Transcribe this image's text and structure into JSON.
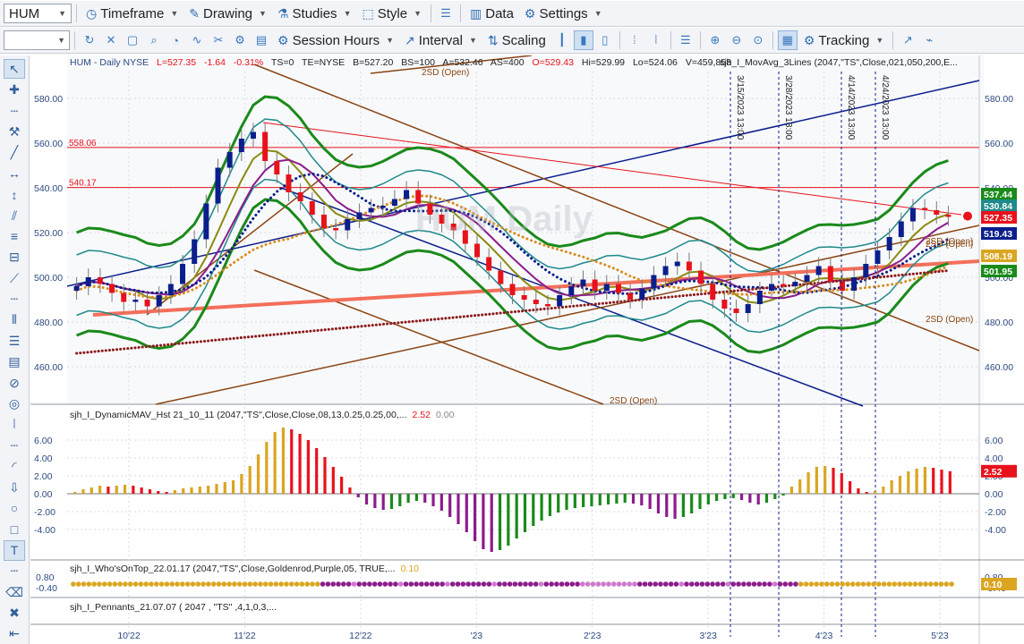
{
  "toolbar_top": {
    "symbol": "HUM",
    "items": [
      "Timeframe",
      "Drawing",
      "Studies",
      "Style",
      "Data",
      "Settings"
    ]
  },
  "toolbar_second": {
    "items": [
      "Session Hours",
      "Interval",
      "Scaling",
      "Tracking"
    ]
  },
  "header": {
    "symbol_line": "HUM - Daily  NYSE",
    "last": "L=527.35",
    "change": "-1.64",
    "pct": "-0.31%",
    "ts": "TS=0",
    "te": "TE=NYSE",
    "bid": "B=527.20",
    "bs": "BS=100",
    "ask": "A=532.46",
    "as": "AS=400",
    "open": "O=529.43",
    "hi": "Hi=529.99",
    "lo": "Lo=524.06",
    "vol": "V=459,858",
    "study": "sjh_I_MovAvg_3Lines (2047,\"TS\",Close,021,050,200,E..."
  },
  "colors": {
    "red": "#e8121b",
    "green": "#1a8a1a",
    "purple": "#8c1c8c",
    "goldenrod": "#daa520",
    "navy": "#0a1e8c",
    "brown": "#8b4513",
    "salmon": "#f36f5a",
    "teal": "#1f8a8a"
  },
  "chart_data": [
    {
      "type": "line",
      "title": "HUM Daily",
      "xlabel": "",
      "ylabel": "",
      "x_tick_labels": [
        "10'22",
        "11'22",
        "12'22",
        "'23",
        "2'23",
        "3'23",
        "4'23",
        "5'23"
      ],
      "y_ticks": [
        460.0,
        480.0,
        500.0,
        520.0,
        540.0,
        560.0,
        580.0
      ],
      "ylim": [
        444,
        592
      ],
      "grid": true,
      "horizontal_levels": [
        {
          "label": "558.06",
          "value": 558.06
        },
        {
          "label": "540.17",
          "value": 540.17
        }
      ],
      "vertical_markers": [
        "3/15/2023 13:00",
        "3/28/2023 13:00",
        "4/14/2023 13:00",
        "4/24/2023 13:00"
      ],
      "annotations": [
        "2SD (Open)",
        "2SD (Open)",
        "2SD (Open)",
        "2SD (Open)",
        "2SD (Open)"
      ],
      "last_values": [
        {
          "label": "537.44",
          "color": "#1a8a1a"
        },
        {
          "label": "530.84",
          "color": "#1f8a8a"
        },
        {
          "label": "527.35",
          "color": "#e8121b"
        },
        {
          "label": "519.43",
          "color": "#0a1e8c"
        },
        {
          "label": "508.19",
          "color": "#daa520"
        },
        {
          "label": "501.95",
          "color": "#1a8a1a"
        }
      ],
      "series": [
        {
          "values": [
            496,
            500,
            497,
            493,
            489,
            490,
            487,
            492,
            497,
            506,
            517,
            533,
            549,
            556,
            562,
            565,
            552,
            546,
            538,
            534,
            528,
            522,
            521,
            526,
            529,
            531,
            532,
            535,
            539,
            533,
            528,
            524,
            521,
            515,
            509,
            503,
            497,
            492,
            490,
            488,
            487,
            492,
            496,
            499,
            494,
            497,
            493,
            490,
            495,
            501,
            505,
            507,
            503,
            497,
            490,
            486,
            484,
            488,
            494,
            497,
            496,
            498,
            501,
            505,
            498,
            494,
            500,
            506,
            512,
            518,
            525,
            531,
            530,
            528,
            527
          ]
        }
      ]
    },
    {
      "type": "bar",
      "title": "sjh_I_DynamicMAV_Hst 21_10_11 (2047,\"TS\",Close,Close,08,13,0.25,0.25,00,...",
      "values_label": [
        "2.52",
        "0.00"
      ],
      "y_ticks": [
        -4.0,
        -2.0,
        0.0,
        2.0,
        4.0,
        6.0
      ],
      "ylim": [
        -7,
        8
      ],
      "last_value": "2.52",
      "values": [
        0.2,
        0.5,
        0.7,
        0.9,
        0.8,
        0.9,
        1.0,
        0.9,
        0.7,
        0.5,
        0.3,
        0.2,
        0.4,
        0.6,
        0.7,
        0.8,
        0.9,
        1.1,
        1.3,
        1.5,
        2.2,
        3.1,
        4.4,
        5.8,
        6.9,
        7.4,
        7.2,
        6.7,
        6.0,
        5.1,
        4.1,
        3.0,
        1.9,
        0.7,
        -0.4,
        -1.2,
        -1.6,
        -1.8,
        -1.7,
        -1.4,
        -1.0,
        -0.8,
        -1.0,
        -1.4,
        -1.9,
        -2.6,
        -3.4,
        -4.3,
        -5.3,
        -6.2,
        -6.5,
        -6.3,
        -5.8,
        -5.0,
        -4.3,
        -3.6,
        -3.0,
        -2.5,
        -2.1,
        -1.8,
        -1.6,
        -1.5,
        -1.4,
        -1.3,
        -1.2,
        -1.1,
        -1.0,
        -1.1,
        -1.3,
        -1.7,
        -2.2,
        -2.6,
        -2.8,
        -2.6,
        -2.2,
        -1.7,
        -1.2,
        -0.8,
        -0.6,
        -0.5,
        -0.7,
        -1.0,
        -1.2,
        -1.0,
        -0.6,
        -0.2,
        0.8,
        1.6,
        2.4,
        3.0,
        3.1,
        2.9,
        2.3,
        1.4,
        0.6,
        0.2,
        0.3,
        0.8,
        1.5,
        2.0,
        2.5,
        2.8,
        3.0,
        2.9,
        2.7,
        2.52
      ]
    },
    {
      "type": "scatter",
      "title": "sjh_I_Who'sOnTop_22.01.17 (2047,\"TS\",Close,Goldenrod,Purple,05, TRUE,...",
      "value_label": "0.10",
      "y_ticks": [
        0.8,
        -0.4
      ],
      "last_value": "0.10"
    },
    {
      "type": "line",
      "title": "sjh_I_Pennants_21.07.07 ( 2047 , \"TS\" ,4,1,0,3,..."
    }
  ]
}
